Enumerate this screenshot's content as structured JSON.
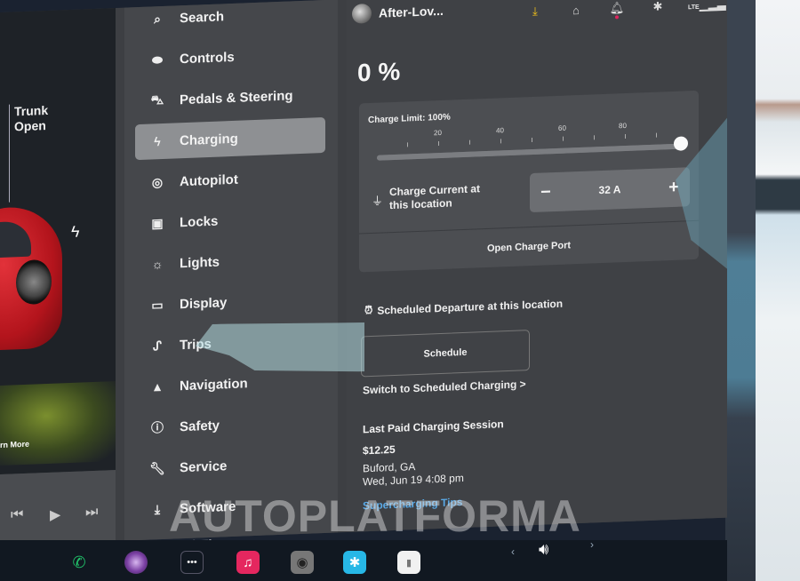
{
  "car": {
    "trunk_status": "Trunk\nOpen",
    "trunk_line1": "Trunk",
    "trunk_line2": "Open",
    "promo_link": "rn More"
  },
  "media": {
    "prev_icon": "⏮",
    "play_icon": "▶",
    "next_icon": "⏭"
  },
  "menu": {
    "items": [
      {
        "label": "Search",
        "icon": "🔍"
      },
      {
        "label": "Controls",
        "icon": "⬭"
      },
      {
        "label": "Pedals & Steering",
        "icon": "🚘"
      },
      {
        "label": "Charging",
        "icon": "ϟ",
        "active": true
      },
      {
        "label": "Autopilot",
        "icon": "◎"
      },
      {
        "label": "Locks",
        "icon": "🔒"
      },
      {
        "label": "Lights",
        "icon": "☼"
      },
      {
        "label": "Display",
        "icon": "▭"
      },
      {
        "label": "Trips",
        "icon": "∫"
      },
      {
        "label": "Navigation",
        "icon": "▲"
      },
      {
        "label": "Safety",
        "icon": "ⓘ"
      },
      {
        "label": "Service",
        "icon": "🔧"
      },
      {
        "label": "Software",
        "icon": "⤓"
      },
      {
        "label": "Wi-Fi",
        "icon": "◠"
      }
    ]
  },
  "header": {
    "profile_name": "After-Lov...",
    "status_icons": [
      "download-icon",
      "garage-icon",
      "bell-icon",
      "bluetooth-icon",
      "lte-signal-icon"
    ],
    "lte_label": "LTE"
  },
  "charging": {
    "battery_percent": "0 %",
    "charge_limit_label": "Charge Limit: 100%",
    "charge_limit_value": 100,
    "tick_labels": [
      "20",
      "40",
      "60",
      "80"
    ],
    "charge_current_label": "Charge Current at this location",
    "charge_current_line1": "Charge Current at",
    "charge_current_line2": "this location",
    "current_value": "32 A",
    "decrement": "−",
    "increment": "+",
    "open_port_label": "Open Charge Port"
  },
  "schedule": {
    "title": "Scheduled Departure at this location",
    "button_label": "Schedule",
    "switch_link": "Switch to Scheduled Charging >"
  },
  "last_session": {
    "title": "Last Paid Charging Session",
    "price": "$12.25",
    "location": "Buford, GA",
    "datetime": "Wed, Jun 19 4:08 pm",
    "tips_link": "Supercharging Tips"
  },
  "taskbar": {
    "apps": [
      "phone-icon",
      "camera-icon",
      "more-icon",
      "music-icon",
      "dashcam-icon",
      "bluetooth-app-icon",
      "notes-icon"
    ],
    "more_glyph": "•••",
    "music_glyph": "♫",
    "bluetooth_glyph": "✱",
    "notes_glyph": "▮",
    "phone_glyph": "✆",
    "vol_prev": "‹",
    "vol_next": "›",
    "vol_glyph": "🔊"
  },
  "watermark": "AUTOPLATFORMA",
  "colors": {
    "accent_link": "#5aa9e6",
    "download_icon": "#f3c218",
    "notification_dot": "#e0245e",
    "active_menu_bg": "#8e9093",
    "car_color": "#c8161e"
  }
}
